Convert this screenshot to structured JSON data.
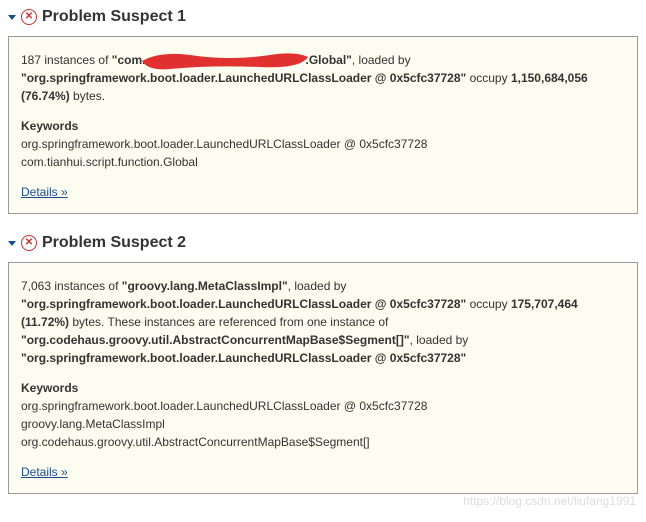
{
  "suspects": [
    {
      "title": "Problem Suspect 1",
      "instance_count": "187",
      "class_prefix": "com.",
      "class_suffix": ".Global",
      "loader": "org.springframework.boot.loader.LaunchedURLClassLoader @ 0x5cfc37728",
      "occupy_bytes": "1,150,684,056",
      "occupy_percent": "(76.74%)",
      "keywords_label": "Keywords",
      "keywords": [
        "org.springframework.boot.loader.LaunchedURLClassLoader @ 0x5cfc37728",
        "com.tianhui.script.function.Global"
      ],
      "details_label": "Details »"
    },
    {
      "title": "Problem Suspect 2",
      "instance_count": "7,063",
      "class_name": "groovy.lang.MetaClassImpl",
      "loader": "org.springframework.boot.loader.LaunchedURLClassLoader @ 0x5cfc37728",
      "occupy_bytes": "175,707,464",
      "occupy_percent": "(11.72%)",
      "ref_text": "These instances are referenced from one instance of",
      "ref_class": "org.codehaus.groovy.util.AbstractConcurrentMapBase$Segment[]",
      "ref_loader": "org.springframework.boot.loader.LaunchedURLClassLoader @ 0x5cfc37728",
      "keywords_label": "Keywords",
      "keywords": [
        "org.springframework.boot.loader.LaunchedURLClassLoader @ 0x5cfc37728",
        "groovy.lang.MetaClassImpl",
        "org.codehaus.groovy.util.AbstractConcurrentMapBase$Segment[]"
      ],
      "details_label": "Details »"
    }
  ],
  "labels": {
    "instances_of": "instances of",
    "loaded_by": "loaded by",
    "occupy": "occupy",
    "bytes": "bytes."
  },
  "watermark": "https://blog.csdn.net/liufang1991"
}
